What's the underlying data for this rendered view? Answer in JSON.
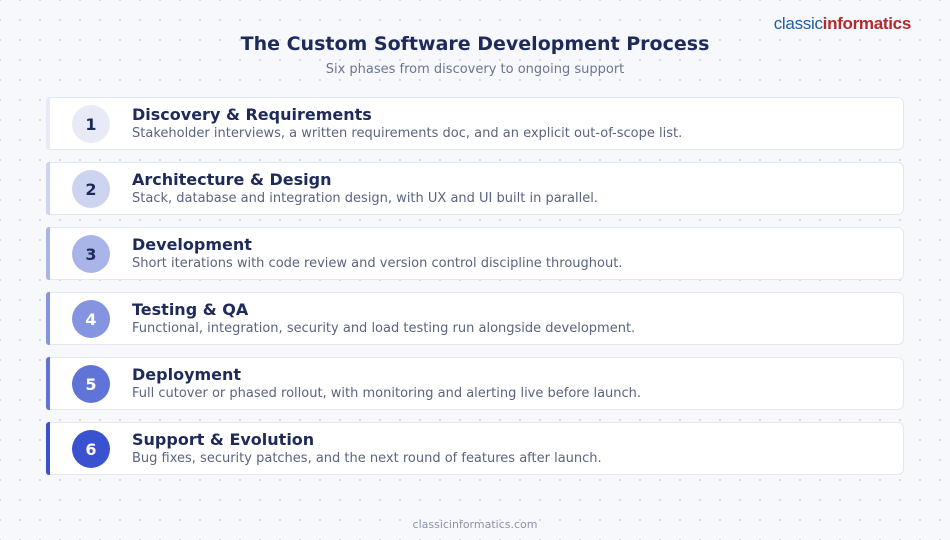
{
  "brand": {
    "part1": "classic",
    "part2": "informatics",
    "color1": "#1d5ea8",
    "color2": "#b5292d"
  },
  "title": "The Custom Software Development Process",
  "subtitle": "Six phases from discovery to ongoing support",
  "steps": [
    {
      "number": "1",
      "title": "Discovery & Requirements",
      "description": "Stakeholder interviews, a written requirements doc, and an explicit out-of-scope list.",
      "accent": "#e8ebf7",
      "number_color": "#1e2a5a"
    },
    {
      "number": "2",
      "title": "Architecture & Design",
      "description": "Stack, database and integration design, with UX and UI built in parallel.",
      "accent": "#cdd4f0",
      "number_color": "#1e2a5a"
    },
    {
      "number": "3",
      "title": "Development",
      "description": "Short iterations with code review and version control discipline throughout.",
      "accent": "#a9b5e8",
      "number_color": "#1e2a5a"
    },
    {
      "number": "4",
      "title": "Testing & QA",
      "description": "Functional, integration, security and load testing run alongside development.",
      "accent": "#8494e0",
      "number_color": "#ffffff"
    },
    {
      "number": "5",
      "title": "Deployment",
      "description": "Full cutover or phased rollout, with monitoring and alerting live before launch.",
      "accent": "#6074d8",
      "number_color": "#ffffff"
    },
    {
      "number": "6",
      "title": "Support & Evolution",
      "description": "Bug fixes, security patches, and the next round of features after launch.",
      "accent": "#3b52d0",
      "number_color": "#ffffff"
    }
  ],
  "footer": "classicinformatics.com"
}
